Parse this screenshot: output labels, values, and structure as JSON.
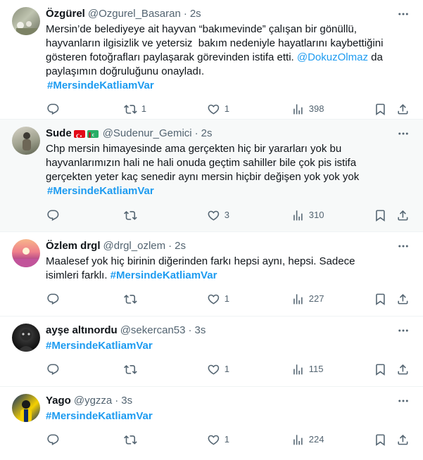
{
  "tweets": [
    {
      "name": "Özgürel",
      "handle": "@Ozgurel_Basaran",
      "time": "2s",
      "text_1": "Mersin’de belediyeye ait hayvan “bakımevinde” çalışan bir gönüllü, hayvanların ilgisizlik ve yetersiz  bakım nedeniyle hayatlarını kaybettiğini gösteren fotoğrafları paylaşarak görevinden istifa etti. ",
      "mention": "@DokuzOlmaz",
      "text_2": " da paylaşımın doğruluğunu onayladı.",
      "hashtag": "#MersindeKatliamVar",
      "replies": "",
      "retweets": "1",
      "likes": "1",
      "views": "398"
    },
    {
      "name": "Sude",
      "handle": "@Sudenur_Gemici",
      "time": "2s",
      "text_1": "Chp mersin himayesinde ama gerçekten hiç bir yararları yok bu hayvanlarımızın hali ne hali onuda geçtim sahiller bile çok pis istifa gerçekten yeter kaç senedir aynı mersin hiçbir değişen yok yok yok",
      "hashtag": "#MersindeKatliamVar",
      "replies": "",
      "retweets": "",
      "likes": "3",
      "views": "310"
    },
    {
      "name": "Özlem drgl",
      "handle": "@drgl_ozlem",
      "time": "2s",
      "text_1": "Maalesef yok hiç birinin diğerinden farkı hepsi aynı, hepsi. Sadece isimleri farklı. ",
      "hashtag": "#MersindeKatliamVar",
      "replies": "",
      "retweets": "",
      "likes": "1",
      "views": "227"
    },
    {
      "name": "ayşe altınordu",
      "handle": "@sekercan53",
      "time": "3s",
      "hashtag": "#MersindeKatliamVar",
      "replies": "",
      "retweets": "",
      "likes": "1",
      "views": "115"
    },
    {
      "name": "Yago",
      "handle": "@ygzza",
      "time": "3s",
      "hashtag": "#MersindeKatliamVar",
      "replies": "",
      "retweets": "",
      "likes": "1",
      "views": "224"
    }
  ],
  "separator": "·",
  "icons": {
    "more": "more-horizontal-icon",
    "reply": "reply-icon",
    "retweet": "retweet-icon",
    "like": "heart-icon",
    "views": "views-chart-icon",
    "bookmark": "bookmark-icon",
    "share": "share-icon",
    "flags": [
      "turkey-flag-icon",
      "turkmenistan-flag-icon"
    ]
  },
  "colors": {
    "link": "#1d9bf0",
    "secondary_text": "#536471",
    "primary_text": "#0f1419",
    "highlight_bg": "#f7f9f9",
    "divider": "#eff3f4"
  }
}
